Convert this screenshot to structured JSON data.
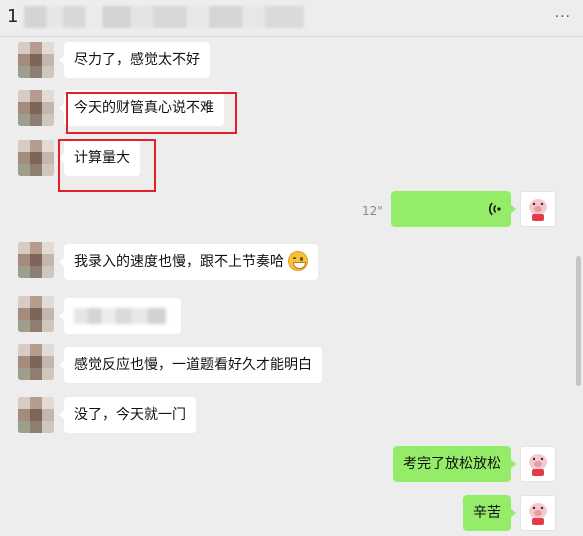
{
  "header": {
    "title_visible_prefix": "1",
    "more_icon": "more-horizontal-icon"
  },
  "messages": [
    {
      "side": "in",
      "text": "尽力了，感觉太不好"
    },
    {
      "side": "in",
      "text": "今天的财管真心说不难"
    },
    {
      "side": "in",
      "text": "计算量大"
    },
    {
      "side": "out",
      "type": "voice",
      "duration": "12\""
    },
    {
      "side": "in",
      "text": "我录入的速度也慢，跟不上节奏哈"
    },
    {
      "side": "in",
      "type": "blurred"
    },
    {
      "side": "in",
      "text": "感觉反应也慢，一道题看好久才能明白"
    },
    {
      "side": "in",
      "text": "没了，今天就一门"
    },
    {
      "side": "out",
      "text": "考完了放松放松"
    },
    {
      "side": "out",
      "text": "辛苦"
    }
  ],
  "colors": {
    "background": "#ededed",
    "incoming_bubble": "#ffffff",
    "outgoing_bubble": "#95ec69",
    "highlight": "#e0202a"
  }
}
